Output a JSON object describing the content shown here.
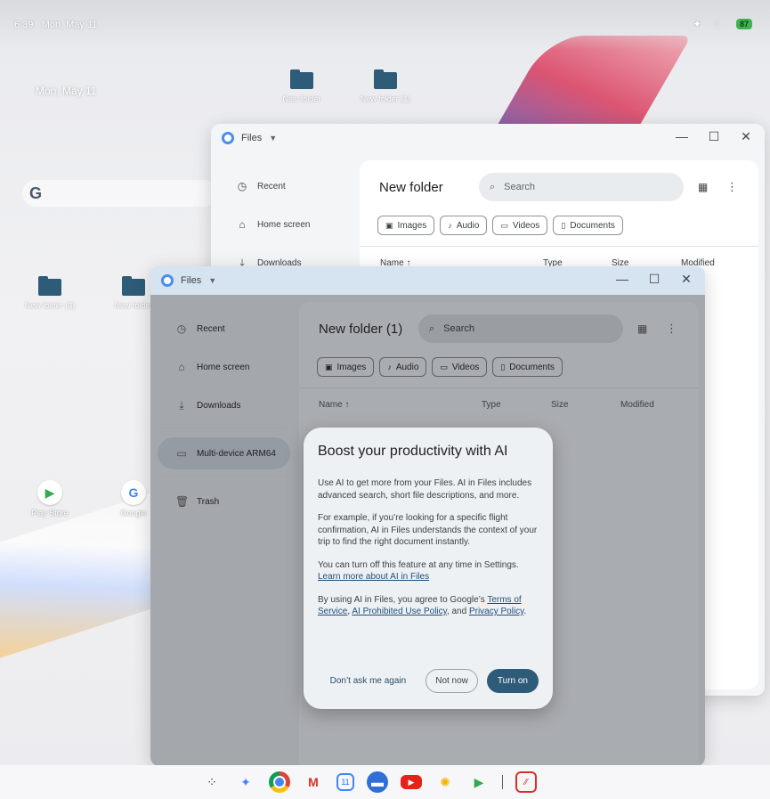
{
  "status_bar": {
    "time": "6:39",
    "date": "Mon, May 11",
    "battery": "87"
  },
  "desktop": {
    "date_widget": "Mon, May 11",
    "folders": [
      {
        "label": "New folder"
      },
      {
        "label": "New folder (1)"
      },
      {
        "label": "New folder (3)"
      },
      {
        "label": "New folder"
      }
    ],
    "apps": [
      {
        "label": "Play Store",
        "icon": "play-store-icon"
      },
      {
        "label": "Google",
        "icon": "google-folder-icon"
      }
    ]
  },
  "back_window": {
    "app_name": "Files",
    "sidebar": [
      {
        "label": "Recent",
        "icon": "clock-icon"
      },
      {
        "label": "Home screen",
        "icon": "home-icon"
      },
      {
        "label": "Downloads",
        "icon": "download-icon"
      }
    ],
    "folder_title": "New folder",
    "search_placeholder": "Search",
    "chips": [
      "Images",
      "Audio",
      "Videos",
      "Documents"
    ],
    "columns": [
      "Name",
      "Type",
      "Size",
      "Modified"
    ]
  },
  "front_window": {
    "app_name": "Files",
    "sidebar": [
      {
        "label": "Recent",
        "icon": "clock-icon"
      },
      {
        "label": "Home screen",
        "icon": "home-icon"
      },
      {
        "label": "Downloads",
        "icon": "download-icon"
      },
      {
        "label": "Multi-device ARM64",
        "icon": "laptop-icon"
      },
      {
        "label": "Trash",
        "icon": "trash-icon"
      }
    ],
    "folder_title": "New folder (1)",
    "search_placeholder": "Search",
    "chips": [
      "Images",
      "Audio",
      "Videos",
      "Documents"
    ],
    "columns": [
      "Name",
      "Type",
      "Size",
      "Modified"
    ]
  },
  "dialog": {
    "title": "Boost your productivity with AI",
    "p1": "Use AI to get more from your Files. AI in Files includes advanced search, short file descriptions, and more.",
    "p2": "For example, if you’re looking for a specific flight confirmation, AI in Files understands the context of your trip to find the right document instantly.",
    "p3": "You can turn off this feature at any time in Settings.",
    "learn_more": "Learn more about AI in Files",
    "p4_prefix": "By using AI in Files, you agree to Google’s ",
    "terms": "Terms of Service",
    "sep1": ", ",
    "policy": "AI Prohibited Use Policy",
    "sep2": ", and ",
    "privacy": "Privacy Policy",
    "p4_suffix": ".",
    "btn_dont_ask": "Don’t ask me again",
    "btn_not_now": "Not now",
    "btn_turn_on": "Turn on"
  },
  "taskbar": {
    "apps": [
      "launcher-icon",
      "gemini-icon",
      "chrome-icon",
      "gmail-icon",
      "calendar-icon",
      "files-icon",
      "youtube-icon",
      "photos-icon",
      "play-store-icon",
      "scrcpy-icon"
    ],
    "calendar_day": "11"
  }
}
